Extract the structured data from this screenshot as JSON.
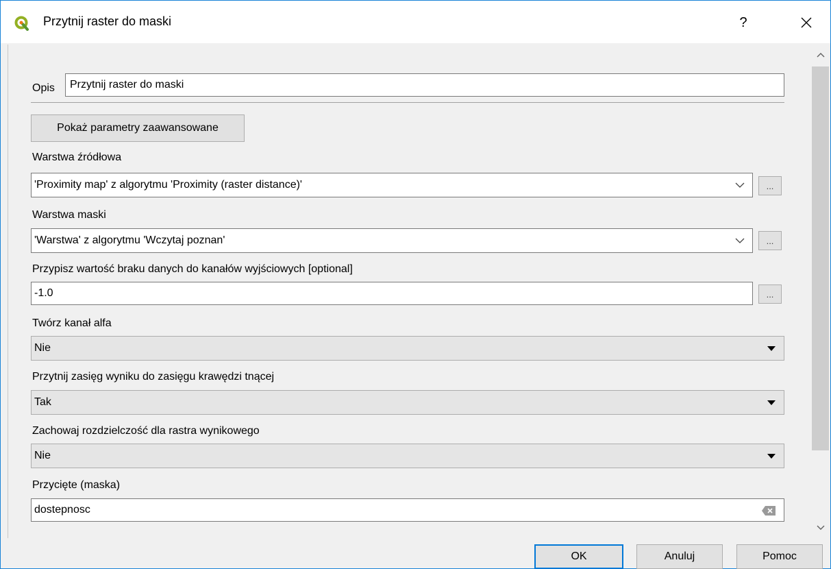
{
  "window": {
    "title": "Przytnij raster do maski",
    "help_label": "?",
    "close_label": "✕"
  },
  "form": {
    "opis_label": "Opis",
    "opis_value": "Przytnij raster do maski",
    "advanced_button": "Pokaż parametry zaawansowane",
    "source_layer": {
      "label": "Warstwa źródłowa",
      "value": "'Proximity map' z algorytmu 'Proximity (raster distance)'",
      "browse_label": "..."
    },
    "mask_layer": {
      "label": "Warstwa maski",
      "value": "'Warstwa' z algorytmu 'Wczytaj poznan'",
      "browse_label": "..."
    },
    "nodata": {
      "label": "Przypisz wartość braku danych do kanałów wyjściowych [optional]",
      "value": "-1.0",
      "browse_label": "..."
    },
    "alpha": {
      "label": "Twórz kanał alfa",
      "value": "Nie"
    },
    "crop_extent": {
      "label": "Przytnij zasięg wyniku do zasięgu krawędzi tnącej",
      "value": "Tak"
    },
    "keep_resolution": {
      "label": "Zachowaj rozdzielczość dla rastra wynikowego",
      "value": "Nie"
    },
    "output": {
      "label": "Przycięte (maska)",
      "value": "dostepnosc"
    }
  },
  "footer": {
    "ok": "OK",
    "cancel": "Anuluj",
    "help": "Pomoc"
  },
  "colors": {
    "accent": "#0078d7",
    "window_border": "#1883d7",
    "qgis_green": "#93b023"
  }
}
